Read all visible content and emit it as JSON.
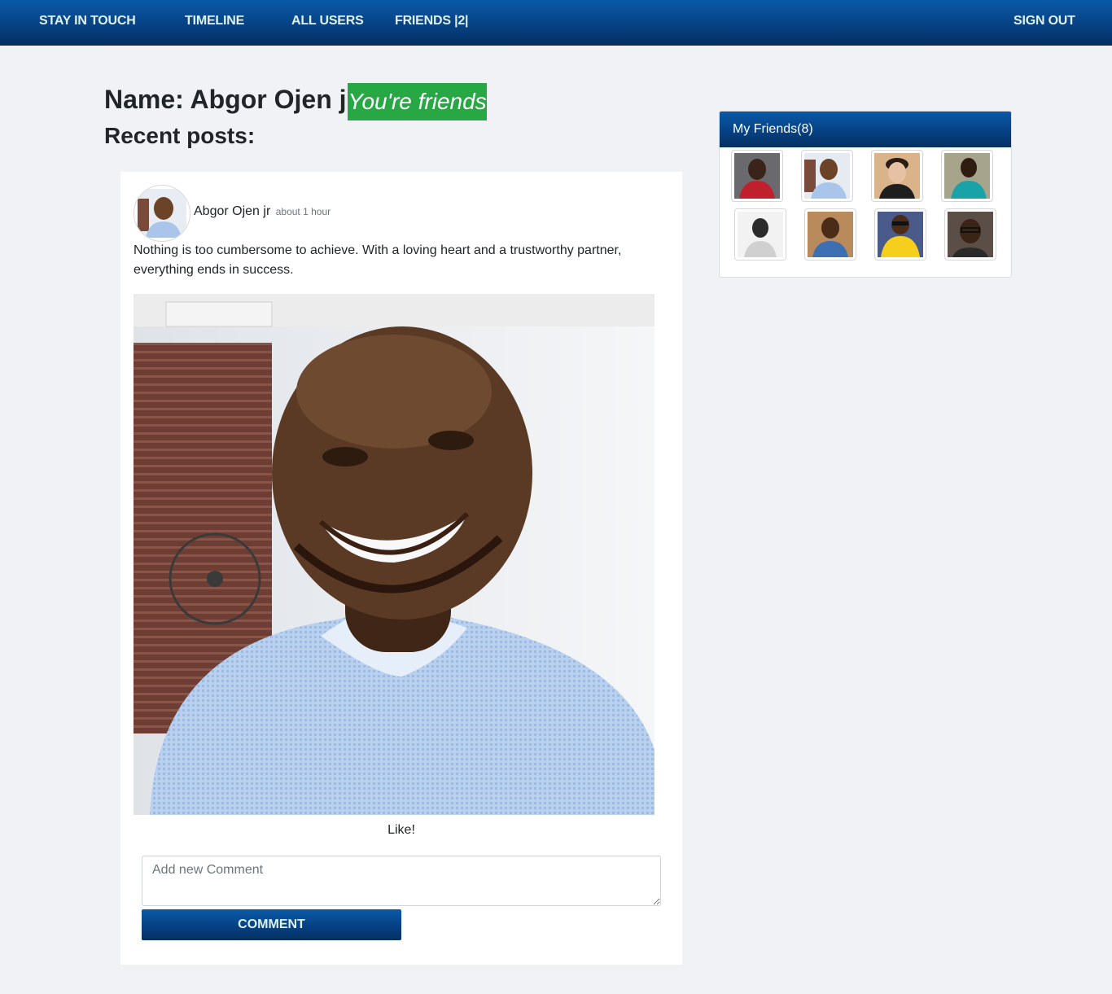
{
  "nav": {
    "brand": "STAY IN TOUCH",
    "timeline": "TIMELINE",
    "all_users": "ALL USERS",
    "friends": "FRIENDS |2|",
    "sign_out": "SIGN OUT"
  },
  "profile": {
    "name": "Name: Abgor Ojen jr",
    "status_badge": "You're friends",
    "recent_posts_title": "Recent posts:"
  },
  "post": {
    "author": "Abgor Ojen jr",
    "time": "about 1 hour",
    "text": "Nothing is too cumbersome to achieve. With a loving heart and a trustworthy partner, everything ends in success.",
    "like_label": "Like!",
    "comment_placeholder": "Add new Comment",
    "comment_button": "COMMENT"
  },
  "friends_panel": {
    "title": "My Friends(8)"
  },
  "colors": {
    "nav_gradient_top": "#0a5aa8",
    "nav_gradient_bottom": "#04305f",
    "nav_text": "#dff1ee",
    "badge_green": "#28a745",
    "page_bg": "#f0f2f5"
  }
}
